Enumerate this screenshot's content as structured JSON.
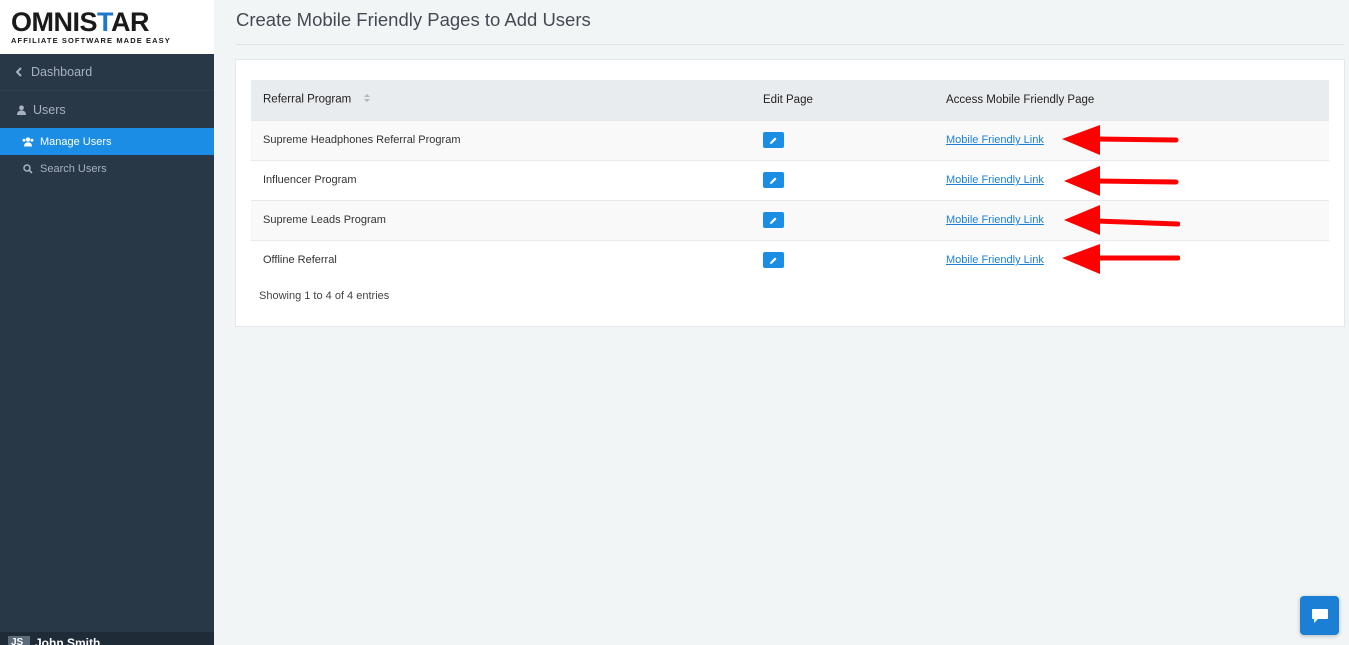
{
  "logo": {
    "main_prefix": "OMNIS",
    "main_star": "T",
    "main_suffix": "AR",
    "tagline": "AFFILIATE SOFTWARE MADE EASY"
  },
  "sidebar": {
    "dashboard": {
      "label": "Dashboard",
      "icon": "chevron-left-icon"
    },
    "users": {
      "label": "Users",
      "icon": "user-icon"
    },
    "subitems": [
      {
        "label": "Manage Users",
        "icon": "users-icon",
        "active": true
      },
      {
        "label": "Search Users",
        "icon": "search-icon",
        "active": false
      }
    ],
    "user": {
      "initials": "JS",
      "name": "John Smith"
    }
  },
  "page": {
    "title": "Create Mobile Friendly Pages to Add Users"
  },
  "table": {
    "headers": {
      "program": "Referral Program",
      "edit": "Edit Page",
      "access": "Access Mobile Friendly Page"
    },
    "rows": [
      {
        "program": "Supreme Headphones Referral Program",
        "link": "Mobile Friendly Link"
      },
      {
        "program": "Influencer Program",
        "link": "Mobile Friendly Link"
      },
      {
        "program": "Supreme Leads Program",
        "link": "Mobile Friendly Link"
      },
      {
        "program": "Offline Referral",
        "link": "Mobile Friendly Link"
      }
    ],
    "footer": "Showing 1 to 4 of 4 entries"
  },
  "colors": {
    "sidebar": "#293846",
    "accent": "#1c8de5",
    "annotation_arrow": "#ff0000"
  }
}
